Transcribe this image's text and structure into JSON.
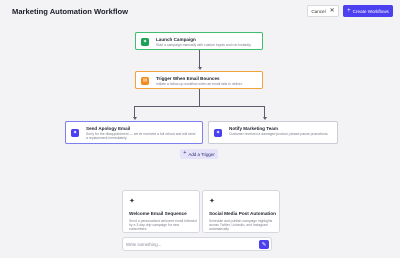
{
  "header": {
    "title": "Marketing Automation Workflow",
    "cancel_label": "Cancel",
    "create_label": "Create Workflows"
  },
  "nodes": {
    "launch": {
      "title": "Launch Campaign",
      "desc": "Start a campaign manually with custom inputs and run instantly."
    },
    "trigger": {
      "title": "Trigger When Email Bounces",
      "desc": "Initiate a follow-up workflow when an email fails to deliver."
    },
    "apology": {
      "title": "Send Apology Email",
      "desc": "Sorry for the disappointment — we've received a full refund and will send a replacement immediately."
    },
    "notify": {
      "title": "Notify Marketing Team",
      "desc": "Customer received a damaged product; please pause promotions."
    }
  },
  "add_trigger_label": "Add a Trigger",
  "templates": [
    {
      "title": "Welcome Email Sequence",
      "desc": "Send a personalized welcome email followed by a 3-day drip campaign for new subscribers."
    },
    {
      "title": "Social Media Post Automation",
      "desc": "Schedule and publish campaign highlights across Twitter, LinkedIn, and Instagram automatically."
    }
  ],
  "composer": {
    "placeholder": "Write something..."
  },
  "colors": {
    "accent": "#4b3ff0",
    "success": "#1aa355",
    "warning": "#f28c1c"
  },
  "icons": {
    "launch": "sparkle-icon",
    "trigger": "mail-icon",
    "apology": "sparkle-icon",
    "notify": "sparkle-icon",
    "send": "pen-icon"
  }
}
